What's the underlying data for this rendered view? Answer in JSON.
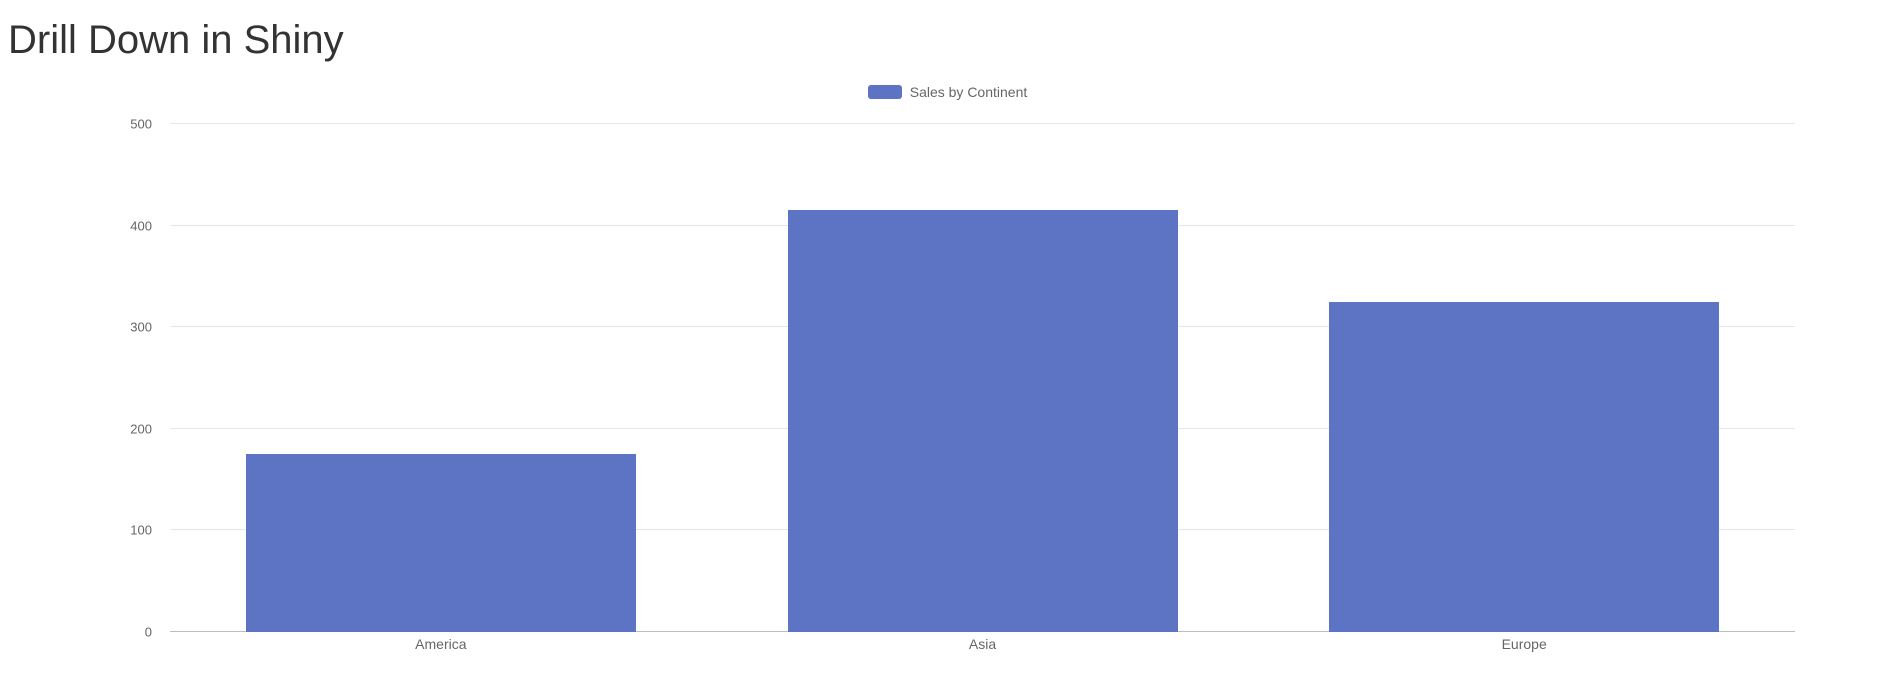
{
  "page_title": "Drill Down in Shiny",
  "legend_label": "Sales by Continent",
  "colors": {
    "bar": "#5d74c5",
    "grid": "#e6e6e6",
    "baseline": "#bdbdbd"
  },
  "chart_data": {
    "type": "bar",
    "title": "",
    "xlabel": "",
    "ylabel": "",
    "ylim": [
      0,
      500
    ],
    "yticks": [
      0,
      100,
      200,
      300,
      400,
      500
    ],
    "categories": [
      "America",
      "Asia",
      "Europe"
    ],
    "series": [
      {
        "name": "Sales by Continent",
        "values": [
          175,
          415,
          325
        ]
      }
    ]
  }
}
